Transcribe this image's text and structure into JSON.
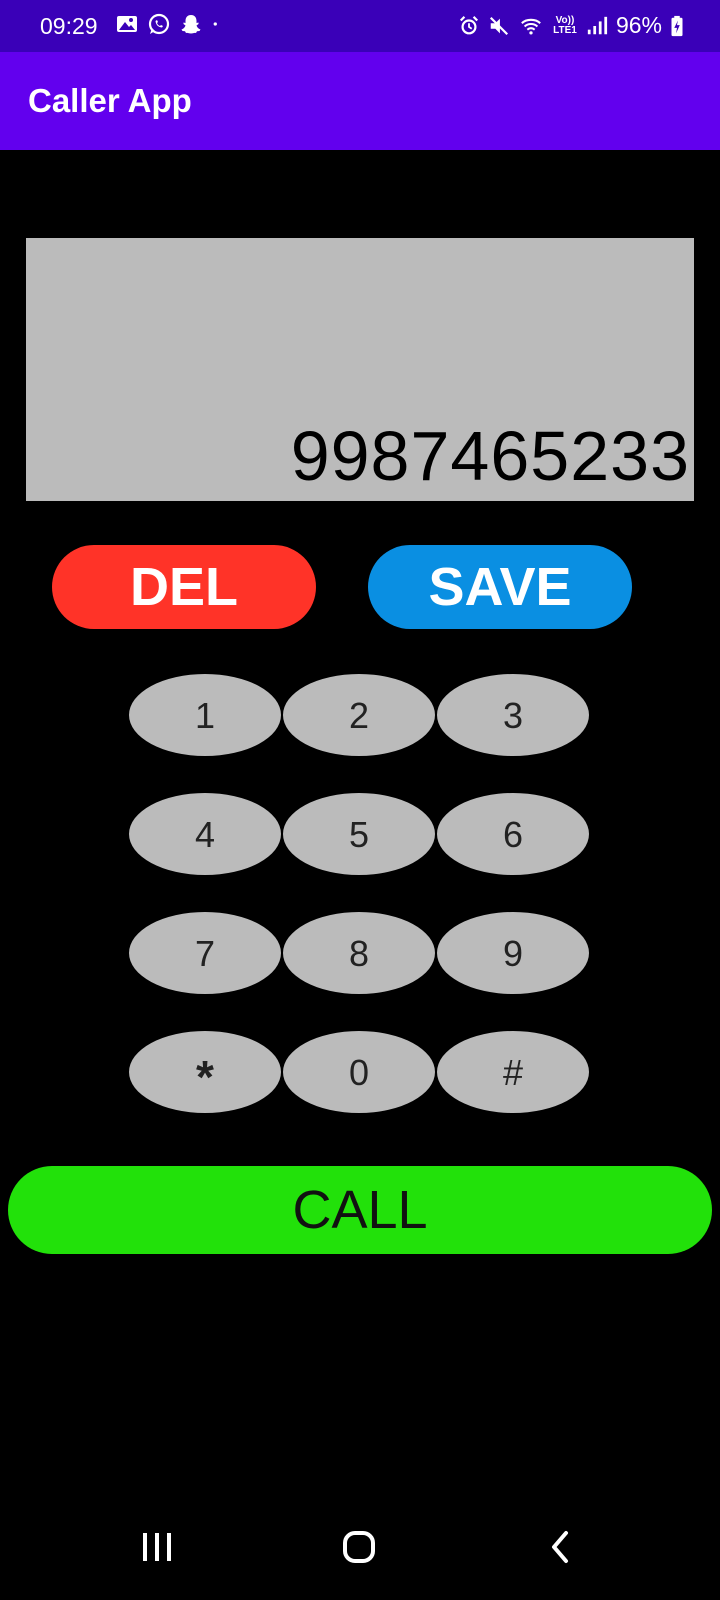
{
  "status_bar": {
    "time": "09:29",
    "battery": "96%",
    "notification_icons": [
      "gallery-icon",
      "whatsapp-icon",
      "snapchat-icon",
      "dot-icon"
    ],
    "system_icons": [
      "alarm-icon",
      "mute-icon",
      "wifi-icon",
      "volte-lte-icon",
      "signal-icon",
      "battery-charging-icon"
    ],
    "volte_label": "Vo)) LTE1"
  },
  "app_bar": {
    "title": "Caller App"
  },
  "display": {
    "number": "9987465233"
  },
  "actions": {
    "del_label": "DEL",
    "save_label": "SAVE"
  },
  "keypad": {
    "keys": [
      "1",
      "2",
      "3",
      "4",
      "5",
      "6",
      "7",
      "8",
      "9",
      "*",
      "0",
      "#"
    ]
  },
  "call": {
    "label": "CALL"
  },
  "nav": {
    "icons": [
      "recent-apps-icon",
      "home-icon",
      "back-icon"
    ]
  },
  "colors": {
    "status_bar": "#3a00b8",
    "app_bar": "#6200ee",
    "display_bg": "#bbbbbb",
    "del": "#ff3328",
    "save": "#0a8fe2",
    "key": "#bbbbbb",
    "call": "#22e10a",
    "background": "#000000"
  }
}
